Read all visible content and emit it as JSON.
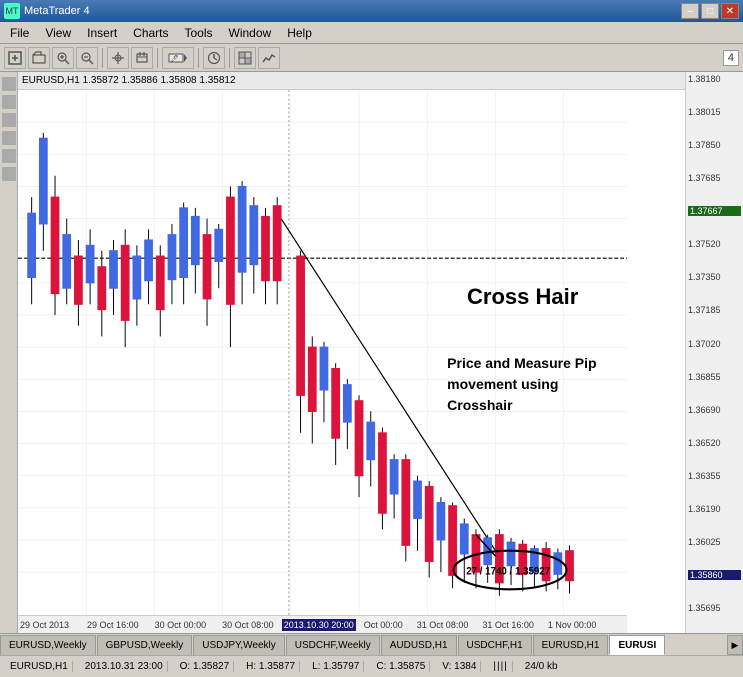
{
  "titleBar": {
    "title": "MetaTrader 4",
    "minimizeLabel": "–",
    "maximizeLabel": "□",
    "closeLabel": "✕"
  },
  "menuBar": {
    "items": [
      "File",
      "View",
      "Insert",
      "Charts",
      "Tools",
      "Window",
      "Help"
    ]
  },
  "toolbar": {
    "buttons": [
      "↑↓",
      "⌖",
      "↖",
      "+",
      "–",
      "→|",
      "|↔|",
      "🖊",
      "⏱",
      "⊞",
      "≡"
    ],
    "rightValue": "4"
  },
  "chartHeader": {
    "symbol": "EURUSD,H1",
    "bid": "1.35872",
    "ask1": "1.35886",
    "ask2": "1.35808",
    "last": "1.35812"
  },
  "priceAxis": {
    "levels": [
      "1.38180",
      "1.38015",
      "1.37850",
      "1.37685",
      "1.37520",
      "1.37350",
      "1.37185",
      "1.37020",
      "1.36855",
      "1.36690",
      "1.36520",
      "1.36355",
      "1.36190",
      "1.36025",
      "1.35860",
      "1.35695"
    ],
    "currentPrice": "1.37667",
    "currentPriceLow": "1.35860"
  },
  "annotations": {
    "crosshairTitle": "Cross Hair",
    "description1": "Price and Measure Pip",
    "description2": "movement using",
    "description3": "Crosshair",
    "ovalText": "27 / 1740 / 1.35927"
  },
  "tabs": {
    "items": [
      {
        "label": "EURUSD,Weekly",
        "active": false
      },
      {
        "label": "GBPUSD,Weekly",
        "active": false
      },
      {
        "label": "USDJPY,Weekly",
        "active": false
      },
      {
        "label": "USDCHF,Weekly",
        "active": false
      },
      {
        "label": "AUDUSD,H1",
        "active": false
      },
      {
        "label": "USDCHF,H1",
        "active": false
      },
      {
        "label": "EURUSD,H1",
        "active": false
      },
      {
        "label": "EURUSI",
        "active": true
      }
    ]
  },
  "statusBar": {
    "pair": "EURUSD,H1",
    "datetime": "2013.10.31 23:00",
    "open": "O: 1.35827",
    "high": "H: 1.35877",
    "low": "L: 1.35797",
    "close": "C: 1.35875",
    "volume": "V: 1384",
    "barIcon": "||||",
    "size": "24/0 kb"
  },
  "timeAxis": {
    "labels": [
      "29 Oct 2013",
      "29 Oct 16:00",
      "30 Oct 00:00",
      "30 Oct 08:00",
      "2013.10.30 20:00",
      "Oct 00:00",
      "31 Oct 08:00",
      "31 Oct 16:00",
      "1 Nov 00:00"
    ]
  }
}
